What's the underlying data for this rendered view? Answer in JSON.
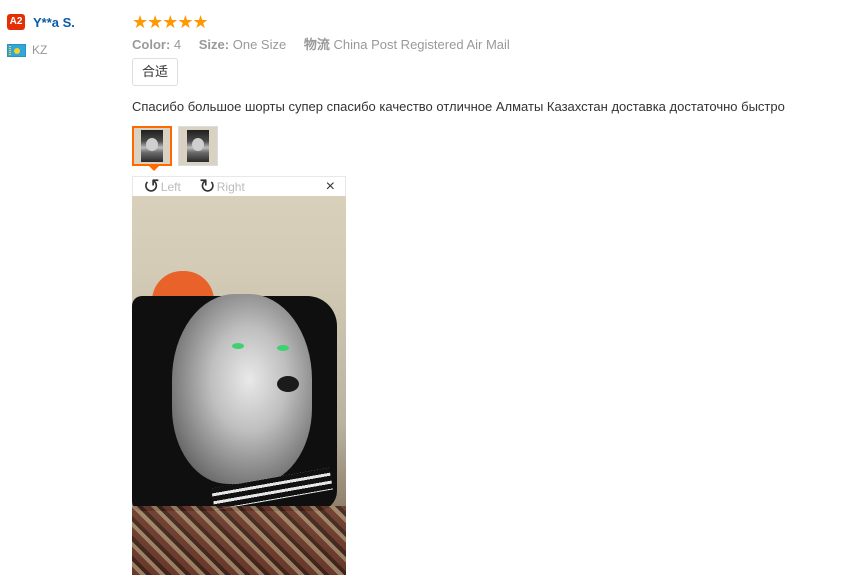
{
  "user": {
    "level_badge": "A2",
    "name": "Y**a S.",
    "country_code": "KZ",
    "flag_icon": "kazakhstan-flag-icon"
  },
  "review": {
    "rating": 5,
    "stars": "★★★★★",
    "star_color": "#ff9900",
    "attributes": [
      {
        "key": "Color:",
        "value": "4"
      },
      {
        "key": "Size:",
        "value": "One Size"
      },
      {
        "key": "物流",
        "value": "China Post Registered Air Mail"
      }
    ],
    "fit_tag": "合适",
    "text": "Спасибо большое шорты супер спасибо качество отличное Алматы Казахстан доставка достаточно быстро",
    "thumbnails_count": 2,
    "active_thumbnail": 1
  },
  "viewer": {
    "rotate_left_label": "Left",
    "rotate_right_label": "Right",
    "close_icon": "×",
    "rotate_left_icon": "↺",
    "rotate_right_icon": "↻"
  },
  "colors": {
    "accent": "#ff6a00",
    "badge": "#e62e04",
    "username": "#0b5aa8"
  }
}
